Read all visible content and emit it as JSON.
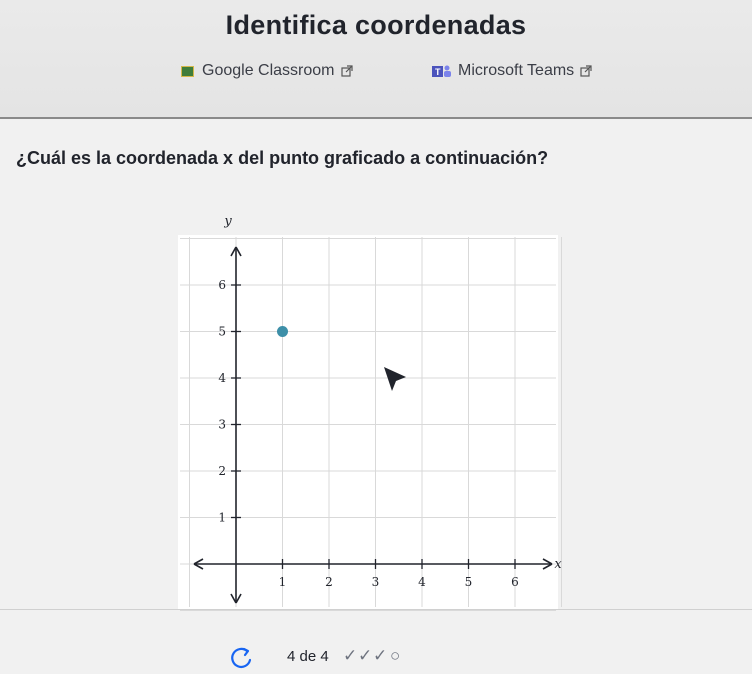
{
  "header": {
    "title": "Identifica coordenadas",
    "integrations": [
      {
        "label": "Google Classroom",
        "icon": "google-classroom-icon"
      },
      {
        "label": "Microsoft Teams",
        "icon": "microsoft-teams-icon"
      }
    ],
    "external_icon": "external-link-icon"
  },
  "question": {
    "text": "¿Cuál es la coordenada x del punto graficado a continuación?"
  },
  "chart_data": {
    "type": "scatter",
    "xlabel": "x",
    "ylabel": "y",
    "xlim": [
      -1,
      7
    ],
    "ylim": [
      -1,
      7
    ],
    "xticks": [
      1,
      2,
      3,
      4,
      5,
      6
    ],
    "yticks": [
      1,
      2,
      3,
      4,
      5,
      6
    ],
    "grid": true,
    "points": [
      {
        "x": 1,
        "y": 5
      }
    ],
    "point_color": "#3d8fa8"
  },
  "footer": {
    "progress_text": "4 de 4",
    "restart_icon": "restart-icon",
    "checks": [
      "✓",
      "✓",
      "✓"
    ],
    "pending": "○"
  }
}
